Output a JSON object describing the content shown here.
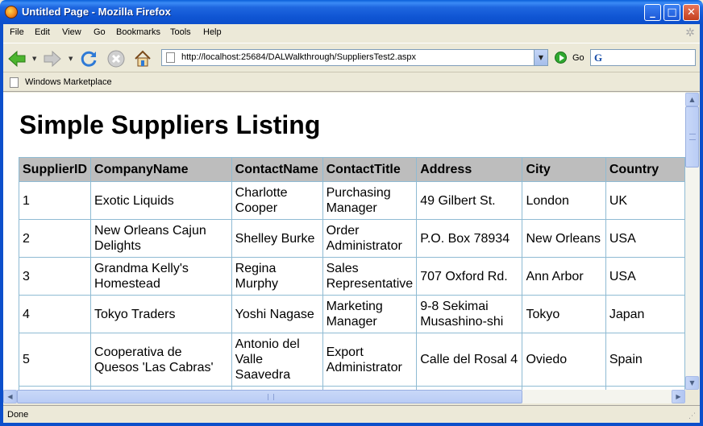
{
  "window": {
    "title": "Untitled Page - Mozilla Firefox",
    "controls": {
      "minimize": "_",
      "maximize": "□",
      "close": "✕"
    }
  },
  "menu": {
    "items": [
      "File",
      "Edit",
      "View",
      "Go",
      "Bookmarks",
      "Tools",
      "Help"
    ]
  },
  "toolbar": {
    "back_icon": "back-arrow-icon",
    "forward_icon": "forward-arrow-icon",
    "reload_icon": "reload-icon",
    "stop_icon": "stop-icon",
    "home_icon": "home-icon",
    "url": "http://localhost:25684/DALWalkthrough/SuppliersTest2.aspx",
    "go_label": "Go",
    "search_value": ""
  },
  "bookmarks": {
    "items": [
      "Windows Marketplace"
    ]
  },
  "page": {
    "title": "Simple Suppliers Listing",
    "table": {
      "columns": [
        "SupplierID",
        "CompanyName",
        "ContactName",
        "ContactTitle",
        "Address",
        "City",
        "Country"
      ],
      "rows": [
        [
          "1",
          "Exotic Liquids",
          "Charlotte Cooper",
          "Purchasing Manager",
          "49 Gilbert St.",
          "London",
          "UK"
        ],
        [
          "2",
          "New Orleans Cajun Delights",
          "Shelley Burke",
          "Order Administrator",
          "P.O. Box 78934",
          "New Orleans",
          "USA"
        ],
        [
          "3",
          "Grandma Kelly's Homestead",
          "Regina Murphy",
          "Sales Representative",
          "707 Oxford Rd.",
          "Ann Arbor",
          "USA"
        ],
        [
          "4",
          "Tokyo Traders",
          "Yoshi Nagase",
          "Marketing Manager",
          "9-8 Sekimai Musashino-shi",
          "Tokyo",
          "Japan"
        ],
        [
          "5",
          "Cooperativa de Quesos 'Las Cabras'",
          "Antonio del Valle Saavedra",
          "Export Administrator",
          "Calle del Rosal 4",
          "Oviedo",
          "Spain"
        ]
      ]
    }
  },
  "status": {
    "text": "Done"
  },
  "colors": {
    "titlebar": "#0C4FCB",
    "chrome": "#ECE9D8",
    "table_header_bg": "#BDBDBD",
    "table_border": "#8FBBD3"
  }
}
